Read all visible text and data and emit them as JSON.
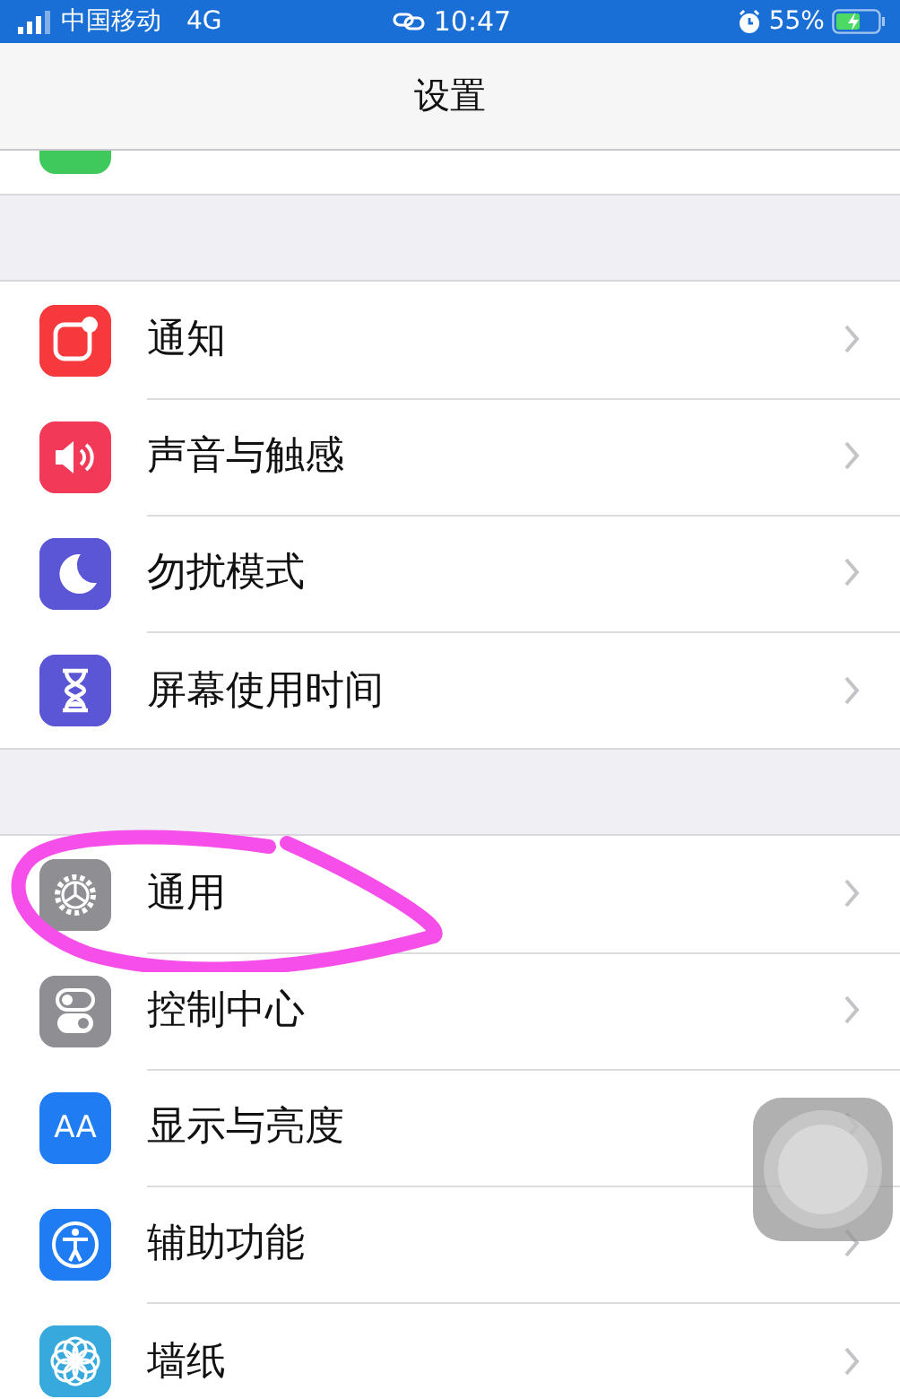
{
  "status_bar": {
    "carrier": "中国移动",
    "network": "4G",
    "time": "10:47",
    "battery": "55%"
  },
  "nav": {
    "title": "设置"
  },
  "sections": [
    {
      "rows": [
        {
          "kind": "partial",
          "color": "#3ec95a"
        }
      ]
    },
    {
      "rows": [
        {
          "kind": "notifications",
          "label": "通知",
          "color": "#f5393c"
        },
        {
          "kind": "sound",
          "label": "声音与触感",
          "color": "#f23a58"
        },
        {
          "kind": "moon",
          "label": "勿扰模式",
          "color": "#5a56d6"
        },
        {
          "kind": "hourglass",
          "label": "屏幕使用时间",
          "color": "#5a56d6"
        }
      ]
    },
    {
      "rows": [
        {
          "kind": "gear",
          "label": "通用",
          "color": "#8e8e93"
        },
        {
          "kind": "toggles",
          "label": "控制中心",
          "color": "#8e8e93"
        },
        {
          "kind": "text",
          "label": "显示与亮度",
          "color": "#1f7cf3",
          "glyph": "AA"
        },
        {
          "kind": "person",
          "label": "辅助功能",
          "color": "#1f7cf3"
        },
        {
          "kind": "flower",
          "label": "墙纸",
          "color": "#37a9dd"
        }
      ]
    }
  ]
}
